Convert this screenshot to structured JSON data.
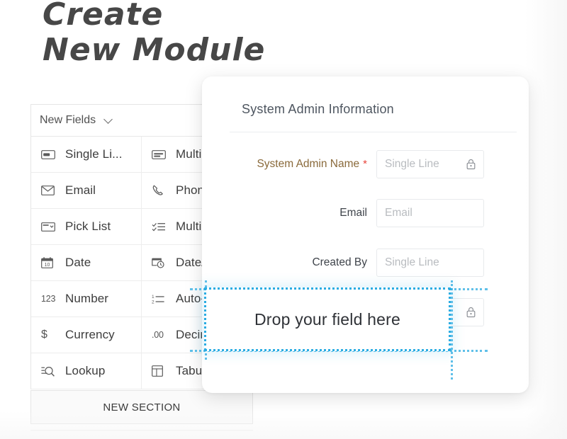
{
  "page": {
    "title": "Create\nNew Module",
    "background_color": "#ffffff"
  },
  "colors": {
    "accent_drop": "#2bace2",
    "required_label": "#8a6a3b",
    "required_star": "#e8443a",
    "placeholder": "#b9bcc0",
    "panel_border": "#e6e6e6"
  },
  "fields_panel": {
    "header_label": "New Fields",
    "header_icon": "chevron-down-icon",
    "items": [
      {
        "label": "Single Li...",
        "icon": "single-line-icon"
      },
      {
        "label": "Multi-",
        "icon": "multi-line-icon"
      },
      {
        "label": "Email",
        "icon": "envelope-icon"
      },
      {
        "label": "Phone",
        "icon": "phone-icon"
      },
      {
        "label": "Pick List",
        "icon": "pick-list-icon"
      },
      {
        "label": "Multi-",
        "icon": "multi-select-icon"
      },
      {
        "label": "Date",
        "icon": "calendar-icon"
      },
      {
        "label": "Date/",
        "icon": "date-time-icon"
      },
      {
        "label": "Number",
        "icon": "123-icon"
      },
      {
        "label": "Auto-",
        "icon": "auto-number-icon"
      },
      {
        "label": "Currency",
        "icon": "dollar-icon"
      },
      {
        "label": "Decim",
        "icon": "decimal-icon"
      },
      {
        "label": "Lookup",
        "icon": "lookup-icon"
      },
      {
        "label": "Tabul",
        "icon": "tabular-icon"
      }
    ],
    "new_section_label": "NEW SECTION"
  },
  "admin_card": {
    "title": "System Admin Information",
    "rows": [
      {
        "label": "System Admin Name",
        "required": true,
        "star": "*",
        "placeholder": "Single Line",
        "lock_icon": "lock-icon"
      },
      {
        "label": "Email",
        "required": false,
        "placeholder": "Email",
        "lock_icon": ""
      },
      {
        "label": "Created By",
        "required": false,
        "placeholder": "Single Line",
        "lock_icon": ""
      },
      {
        "label": "",
        "required": false,
        "placeholder": "",
        "lock_icon": "lock-icon"
      }
    ]
  },
  "drop_zone": {
    "label": "Drop your field here"
  }
}
